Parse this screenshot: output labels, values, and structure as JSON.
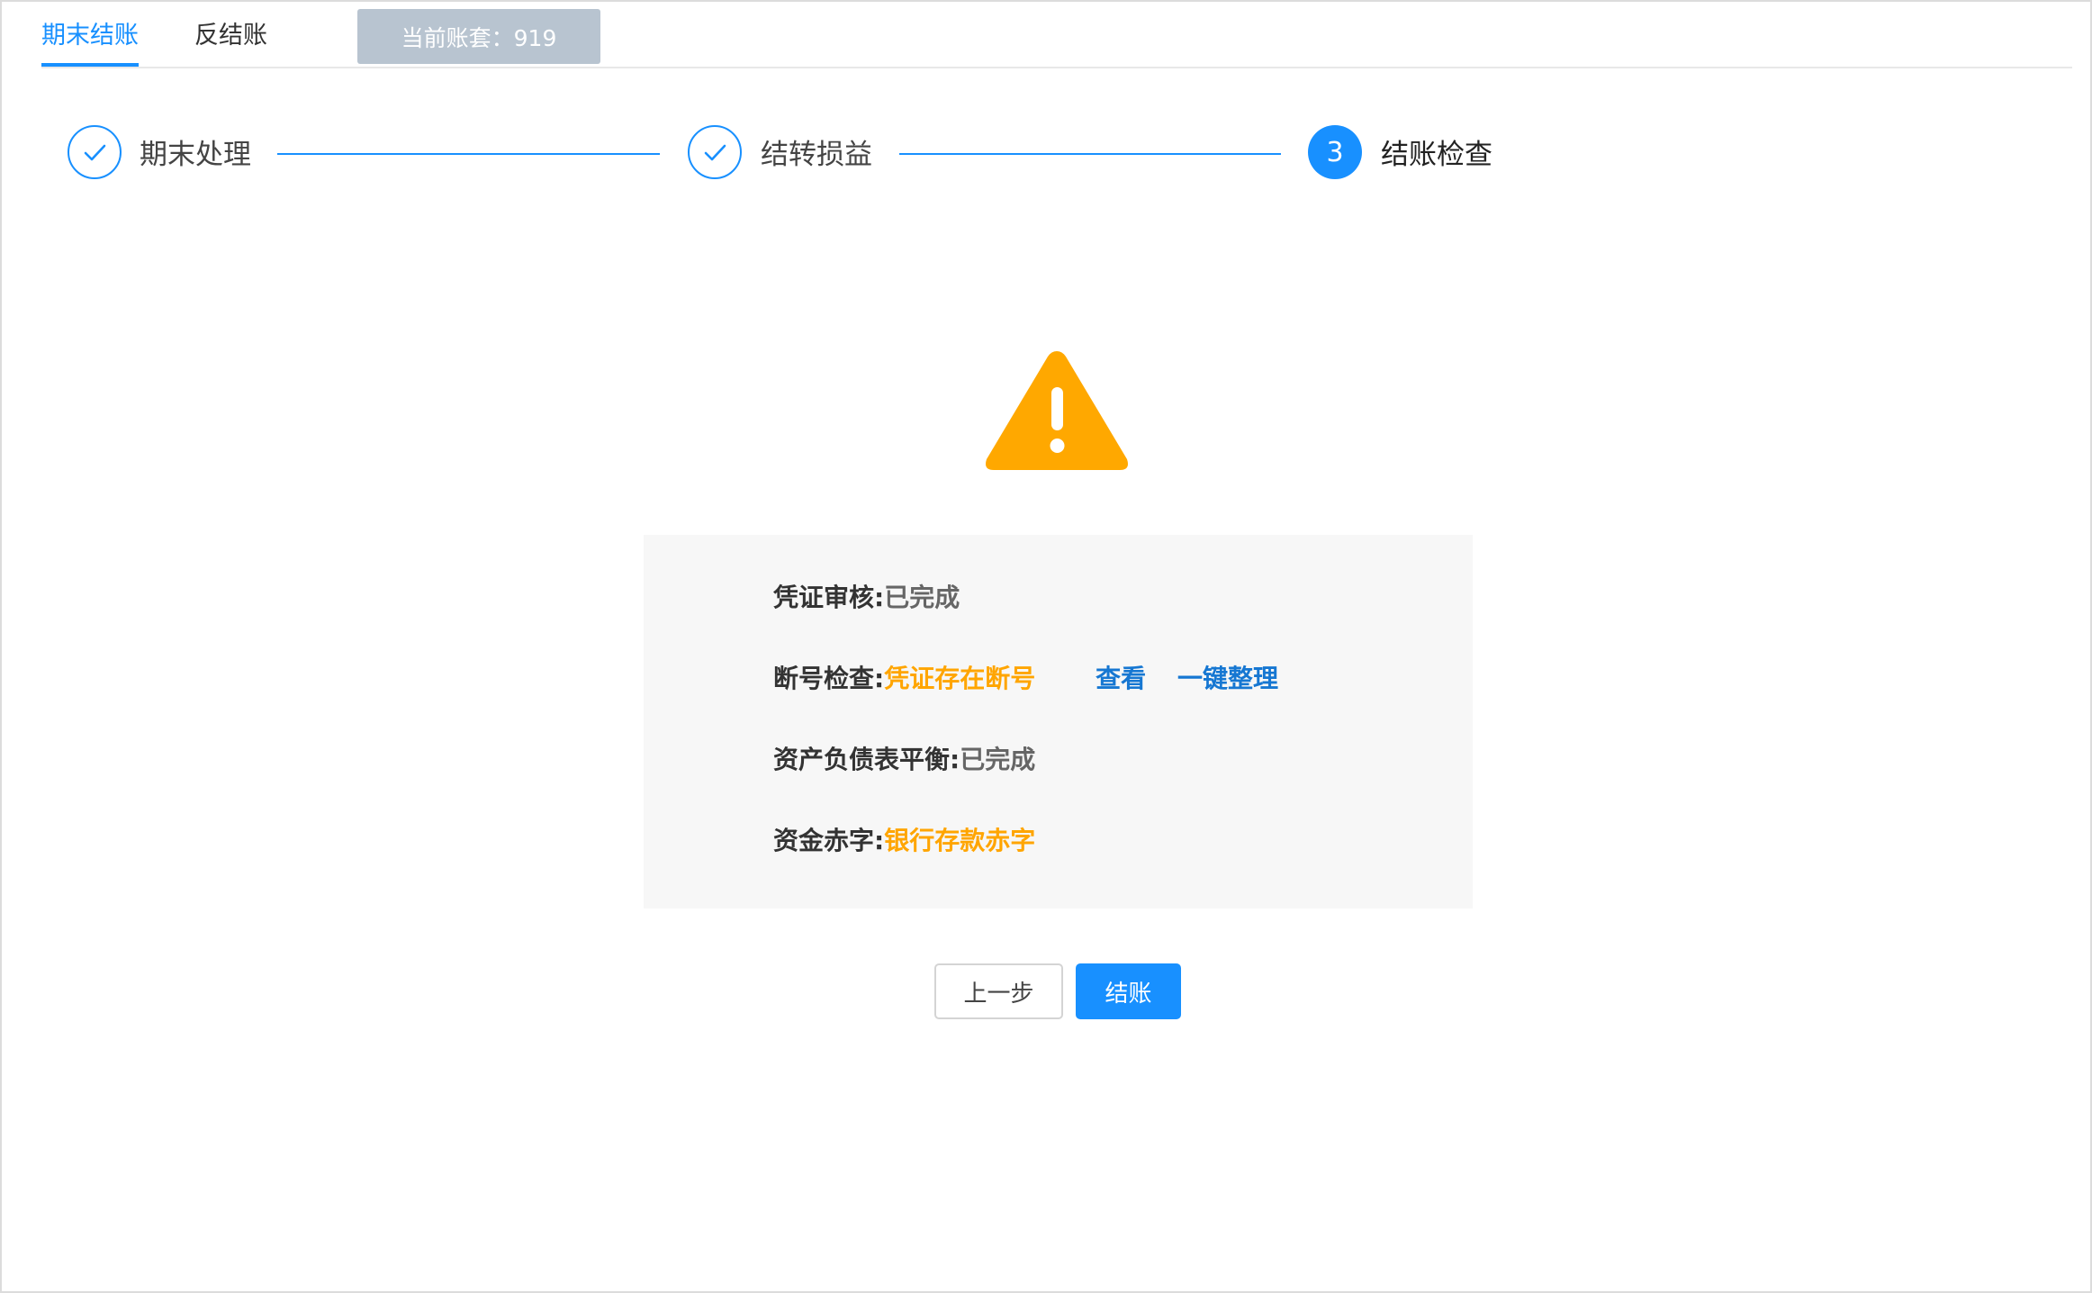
{
  "tabs": {
    "closing": "期末结账",
    "reverse": "反结账"
  },
  "account": {
    "label": "当前账套：919"
  },
  "steps": [
    {
      "label": "期末处理",
      "state": "done",
      "icon": "check-icon"
    },
    {
      "label": "结转损益",
      "state": "done",
      "icon": "check-icon"
    },
    {
      "label": "结账检查",
      "state": "current",
      "number": "3"
    }
  ],
  "warning": {
    "icon": "warning-triangle-icon",
    "color": "#ffa800"
  },
  "checks": [
    {
      "key": "凭证审核:",
      "value": "已完成",
      "status": "ok"
    },
    {
      "key": "断号检查:",
      "value": "凭证存在断号",
      "status": "warn",
      "actions": [
        "查看",
        "一键整理"
      ]
    },
    {
      "key": "资产负债表平衡:",
      "value": "已完成",
      "status": "ok"
    },
    {
      "key": "资金赤字:",
      "value": "银行存款赤字",
      "status": "warn"
    }
  ],
  "buttons": {
    "prev": "上一步",
    "close": "结账"
  },
  "colors": {
    "primary": "#1890ff",
    "warn": "#ffa500",
    "link": "#1677d2",
    "pill": "#b8c4d0"
  }
}
